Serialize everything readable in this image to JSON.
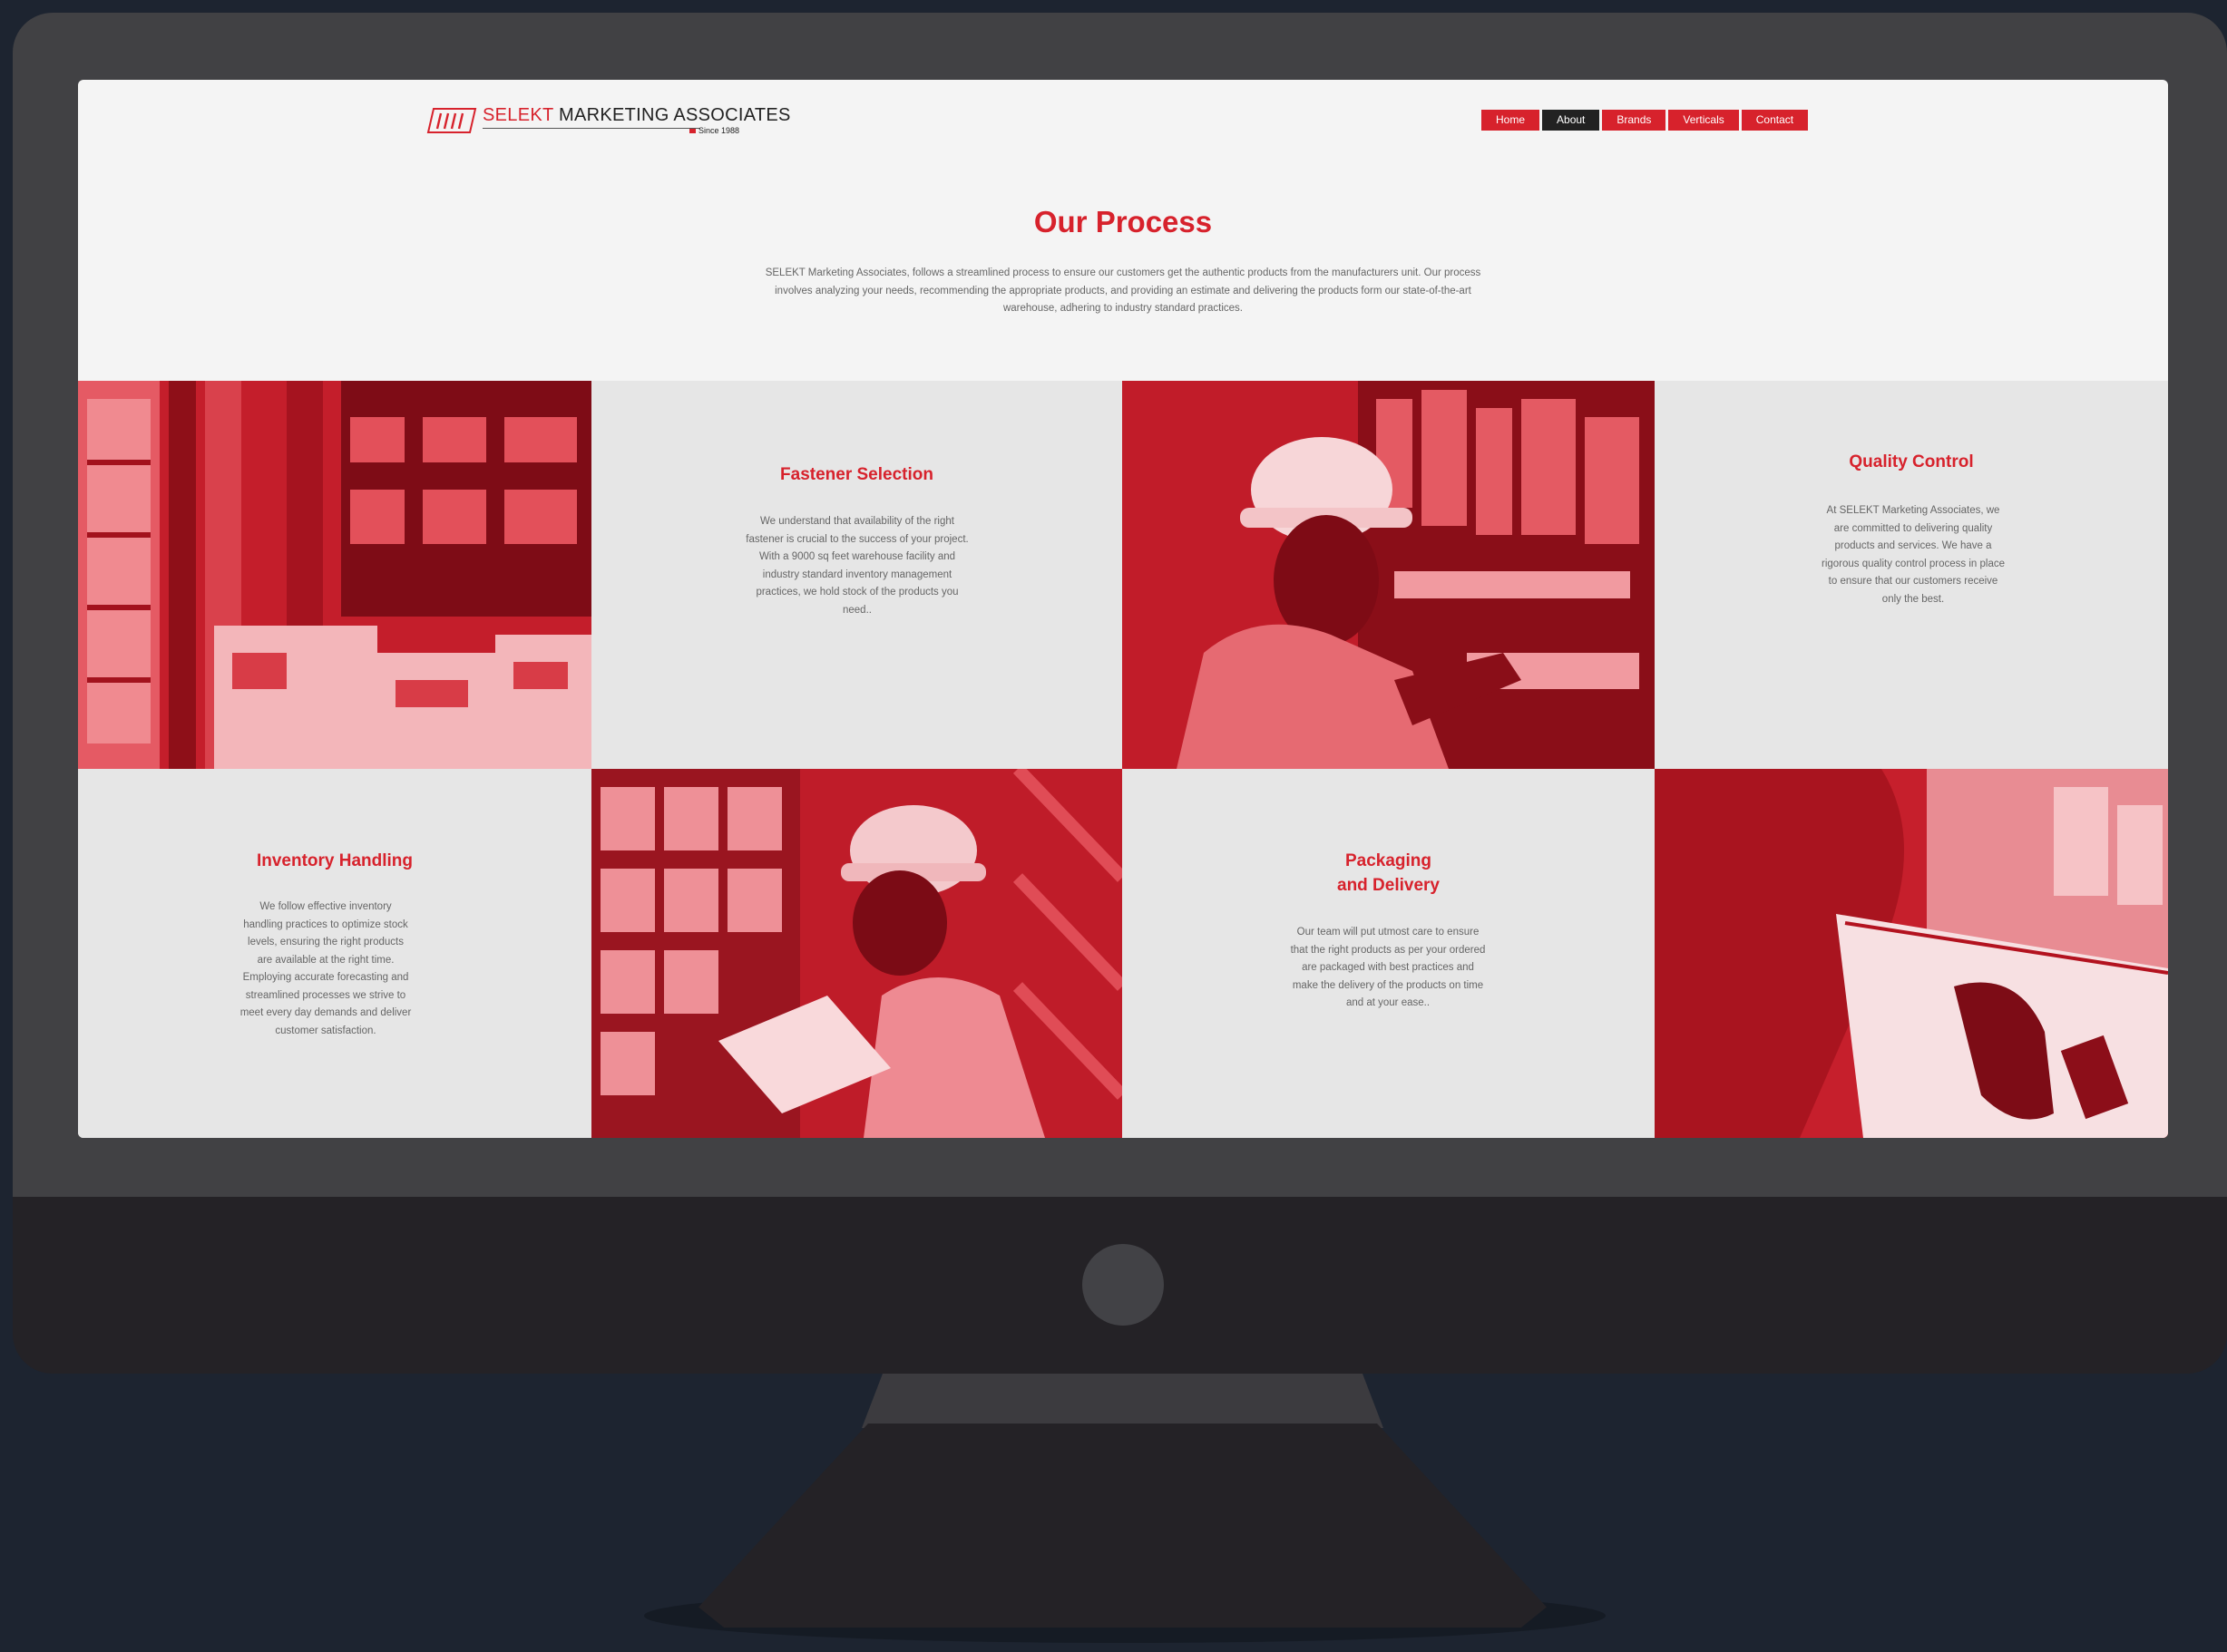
{
  "brand": {
    "logo_mark": "SMA",
    "name_part1": "SELEKT",
    "name_part2": "MARKETING ASSOCIATES",
    "since": "Since 1988"
  },
  "nav": [
    {
      "label": "Home",
      "active": false
    },
    {
      "label": "About",
      "active": true
    },
    {
      "label": "Brands",
      "active": false
    },
    {
      "label": "Verticals",
      "active": false
    },
    {
      "label": "Contact",
      "active": false
    }
  ],
  "hero": {
    "title": "Our Process",
    "intro": "SELEKT Marketing Associates, follows a streamlined process to ensure our customers get the authentic products from the manufacturers unit. Our process involves analyzing your needs, recommending the appropriate products, and providing an estimate and delivering the products form our state-of-the-art warehouse, adhering to industry standard practices."
  },
  "process": [
    {
      "title": "Fastener Selection",
      "body": "We understand that availability of the right fastener is crucial to the success of your project. With a 9000 sq feet warehouse facility and industry standard inventory management practices, we hold stock of the products you need.."
    },
    {
      "title": "Quality Control",
      "body": "At SELEKT Marketing Associates, we are committed to delivering quality products and services. We have a rigorous quality control process in place to ensure that our customers receive only the best."
    },
    {
      "title": "Inventory Handling",
      "body": "We follow effective inventory handling practices to optimize stock levels, ensuring the right products are available at the right time. Employing accurate forecasting and streamlined processes we strive to meet every day demands and deliver customer satisfaction."
    },
    {
      "title_line1": "Packaging",
      "title_line2": "and Delivery",
      "body": "Our team will put utmost care to ensure that the right products as per your ordered are packaged with best practices and make the delivery of the products on time and at your ease.."
    }
  ],
  "colors": {
    "brand_red": "#d7222c",
    "nav_active": "#222222",
    "page_bg": "#1d2430"
  }
}
